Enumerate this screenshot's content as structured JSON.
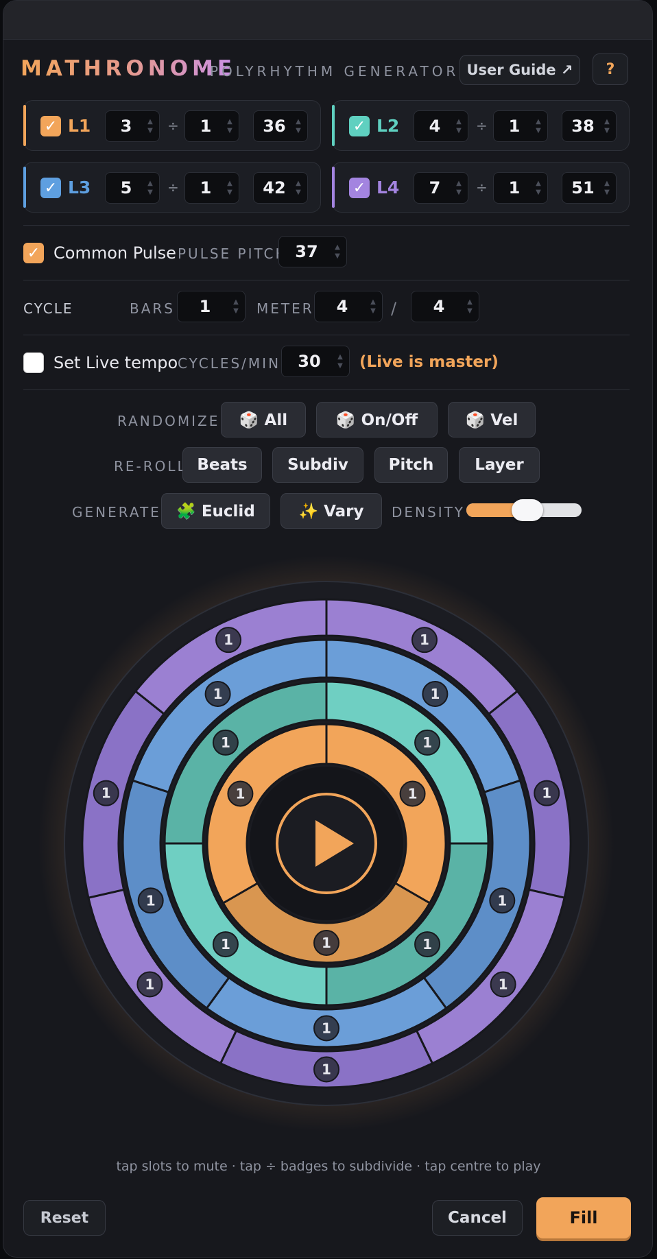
{
  "header": {
    "title": "MATHRONOME",
    "subtitle": "POLYRHYTHM GENERATOR",
    "user_guide_label": "User Guide ↗",
    "help_label": "?"
  },
  "layers": [
    {
      "name": "L1",
      "checked": true,
      "color": "#f2a55a",
      "beats": "3",
      "subdiv": "1",
      "pitch": "36",
      "divider": "÷"
    },
    {
      "name": "L2",
      "checked": true,
      "color": "#5fd0c0",
      "beats": "4",
      "subdiv": "1",
      "pitch": "38",
      "divider": "÷"
    },
    {
      "name": "L3",
      "checked": true,
      "color": "#5e9fe0",
      "beats": "5",
      "subdiv": "1",
      "pitch": "42",
      "divider": "÷"
    },
    {
      "name": "L4",
      "checked": true,
      "color": "#a384e0",
      "beats": "7",
      "subdiv": "1",
      "pitch": "51",
      "divider": "÷"
    }
  ],
  "common_pulse": {
    "label": "Common Pulse",
    "checked": true,
    "pitch_label": "PULSE PITCH",
    "pitch": "37"
  },
  "cycle": {
    "label": "CYCLE",
    "bars_label": "BARS",
    "bars": "1",
    "meter_label": "METER",
    "meter_num": "4",
    "meter_sep": "/",
    "meter_den": "4"
  },
  "live": {
    "label": "Set Live tempo",
    "checked": false,
    "rate_label": "CYCLES/MIN",
    "rate": "30",
    "note": "(Live is master)"
  },
  "randomize": {
    "label": "RANDOMIZE",
    "buttons": [
      "🎲 All",
      "🎲 On/Off",
      "🎲 Vel"
    ]
  },
  "reroll": {
    "label": "RE-ROLL",
    "buttons": [
      "Beats",
      "Subdiv",
      "Pitch",
      "Layer"
    ]
  },
  "generate": {
    "label": "GENERATE",
    "euclid": "🧩 Euclid",
    "vary": "✨ Vary",
    "density_label": "DENSITY",
    "density": 0.53
  },
  "wheel": {
    "badge": "1",
    "play_icon": "play-icon"
  },
  "hint": "tap slots to mute · tap ÷ badges to subdivide · tap centre to play",
  "footer": {
    "reset": "Reset",
    "cancel": "Cancel",
    "fill": "Fill"
  }
}
